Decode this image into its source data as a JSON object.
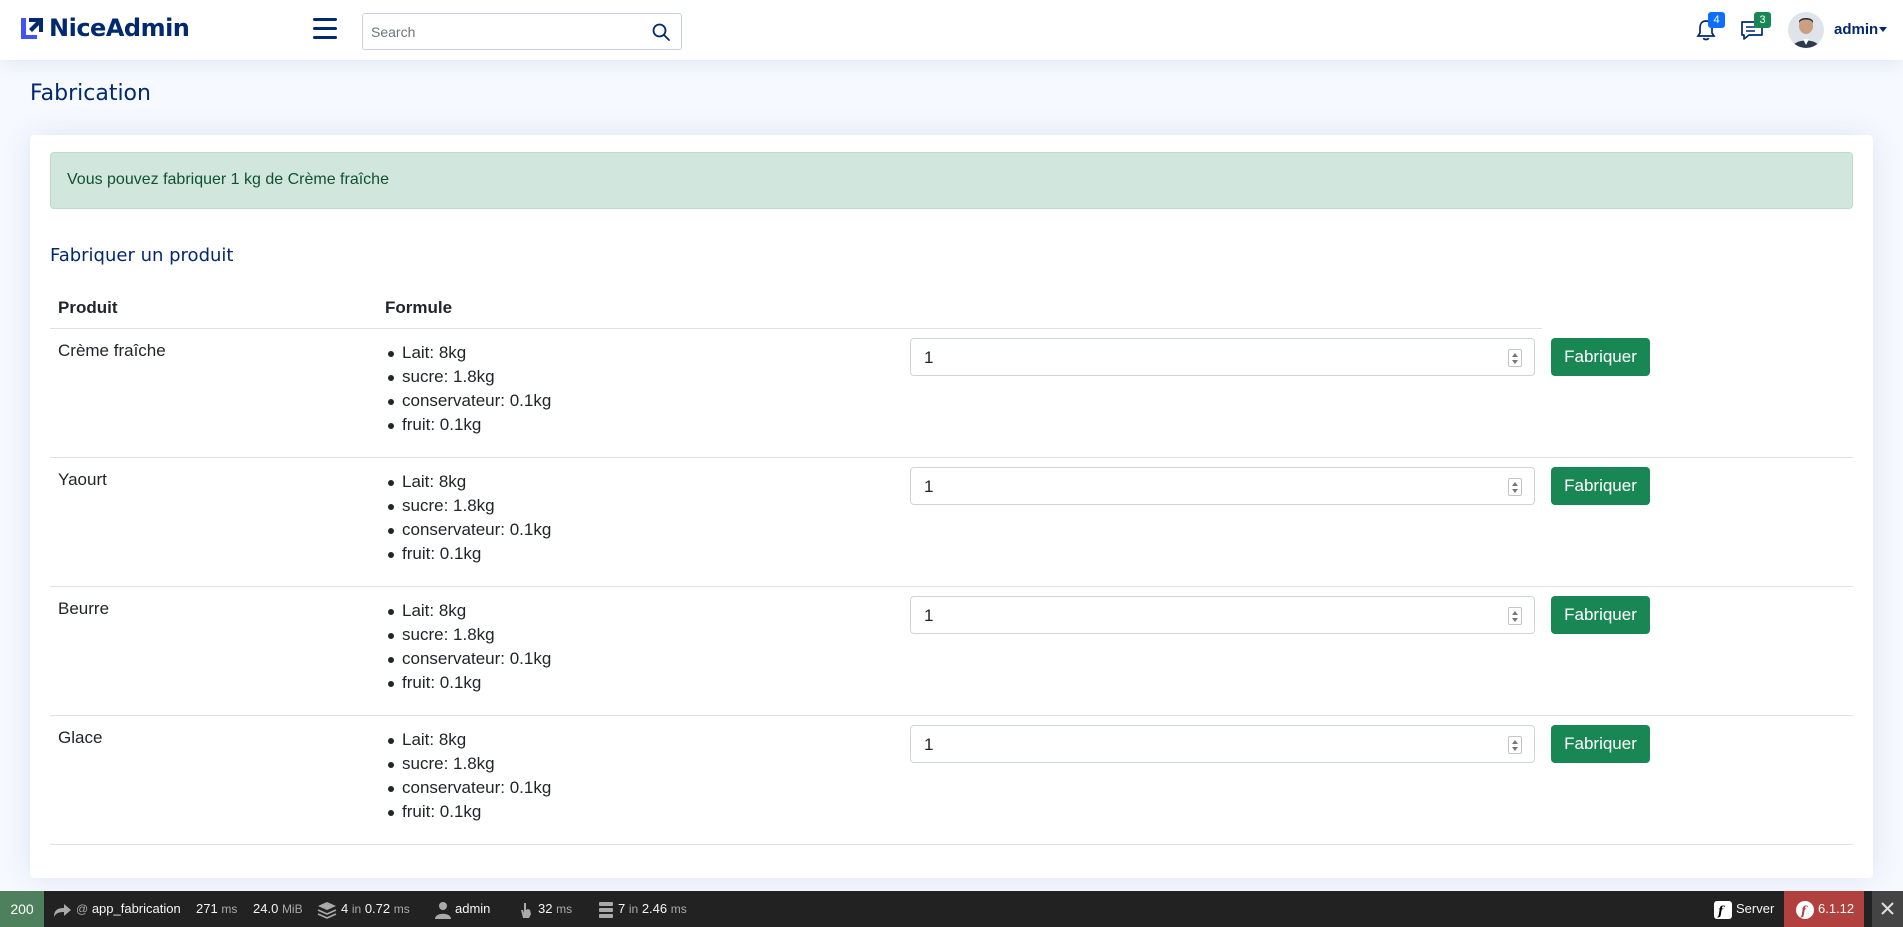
{
  "header": {
    "brand": "NiceAdmin",
    "search_placeholder": "Search",
    "notifications_count": "4",
    "messages_count": "3",
    "user_name": "admin",
    "colors": {
      "brand": "#4154f1",
      "notif_badge": "#0d6efd",
      "msg_badge": "#198754"
    }
  },
  "page": {
    "title": "Fabrication",
    "alert": "Vous pouvez fabriquer 1 kg de Crème fraîche",
    "section_title": "Fabriquer un produit",
    "columns": [
      "Produit",
      "Formule"
    ],
    "button_label": "Fabriquer",
    "rows": [
      {
        "name": "Crème fraîche",
        "formula": [
          "Lait: 8kg",
          "sucre: 1.8kg",
          "conservateur: 0.1kg",
          "fruit: 0.1kg"
        ],
        "quantity": "1"
      },
      {
        "name": "Yaourt",
        "formula": [
          "Lait: 8kg",
          "sucre: 1.8kg",
          "conservateur: 0.1kg",
          "fruit: 0.1kg"
        ],
        "quantity": "1"
      },
      {
        "name": "Beurre",
        "formula": [
          "Lait: 8kg",
          "sucre: 1.8kg",
          "conservateur: 0.1kg",
          "fruit: 0.1kg"
        ],
        "quantity": "1"
      },
      {
        "name": "Glace",
        "formula": [
          "Lait: 8kg",
          "sucre: 1.8kg",
          "conservateur: 0.1kg",
          "fruit: 0.1kg"
        ],
        "quantity": "1"
      }
    ]
  },
  "toolbar": {
    "status_code": "200",
    "route_prefix": "@",
    "route": "app_fabrication",
    "time_value": "271",
    "time_unit": "ms",
    "memory_value": "24.0",
    "memory_unit": "MiB",
    "twig_count": "4",
    "twig_in": "in",
    "twig_time": "0.72",
    "twig_unit": "ms",
    "user": "admin",
    "cache_value": "32",
    "cache_unit": "ms",
    "db_count": "7",
    "db_in": "in",
    "db_time": "2.46",
    "db_unit": "ms",
    "server_label": "Server",
    "symfony_version": "6.1.12"
  }
}
